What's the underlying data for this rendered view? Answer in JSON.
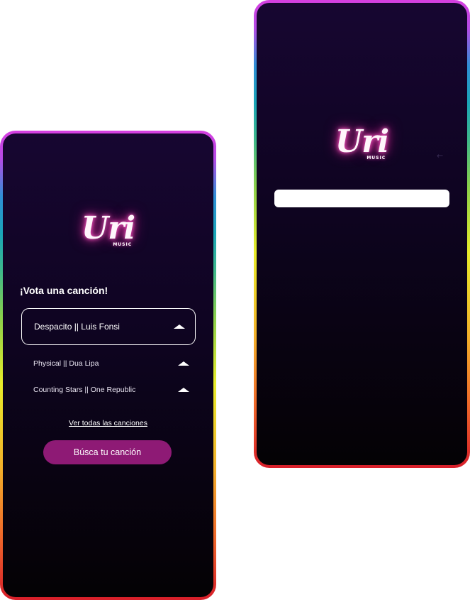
{
  "vote_screen": {
    "logo": {
      "script_text": "Uri",
      "sub_text": "MUSIC"
    },
    "title": "¡Vota una canción!",
    "selected_song": {
      "label": "Despacito || Luis Fonsi",
      "icon": "upvote-caret-icon"
    },
    "songs": [
      {
        "label": "Physical || Dua Lipa",
        "icon": "upvote-caret-icon"
      },
      {
        "label": "Counting Stars || One Republic",
        "icon": "upvote-caret-icon"
      }
    ],
    "see_all_link": "Ver todas las canciones",
    "search_button": "Búsca tu canción"
  },
  "search_screen": {
    "logo": {
      "script_text": "Uri",
      "sub_text": "MUSIC"
    },
    "search_input": {
      "value": "",
      "placeholder": ""
    },
    "back_arrow": "←"
  },
  "colors": {
    "screen_top": "#170631",
    "screen_bottom": "#040204",
    "accent_button": "#8e1a75",
    "logo_glow": "#ff5fc8",
    "frame_top": "#d63fe0",
    "frame_bottom": "#d81e2a"
  }
}
